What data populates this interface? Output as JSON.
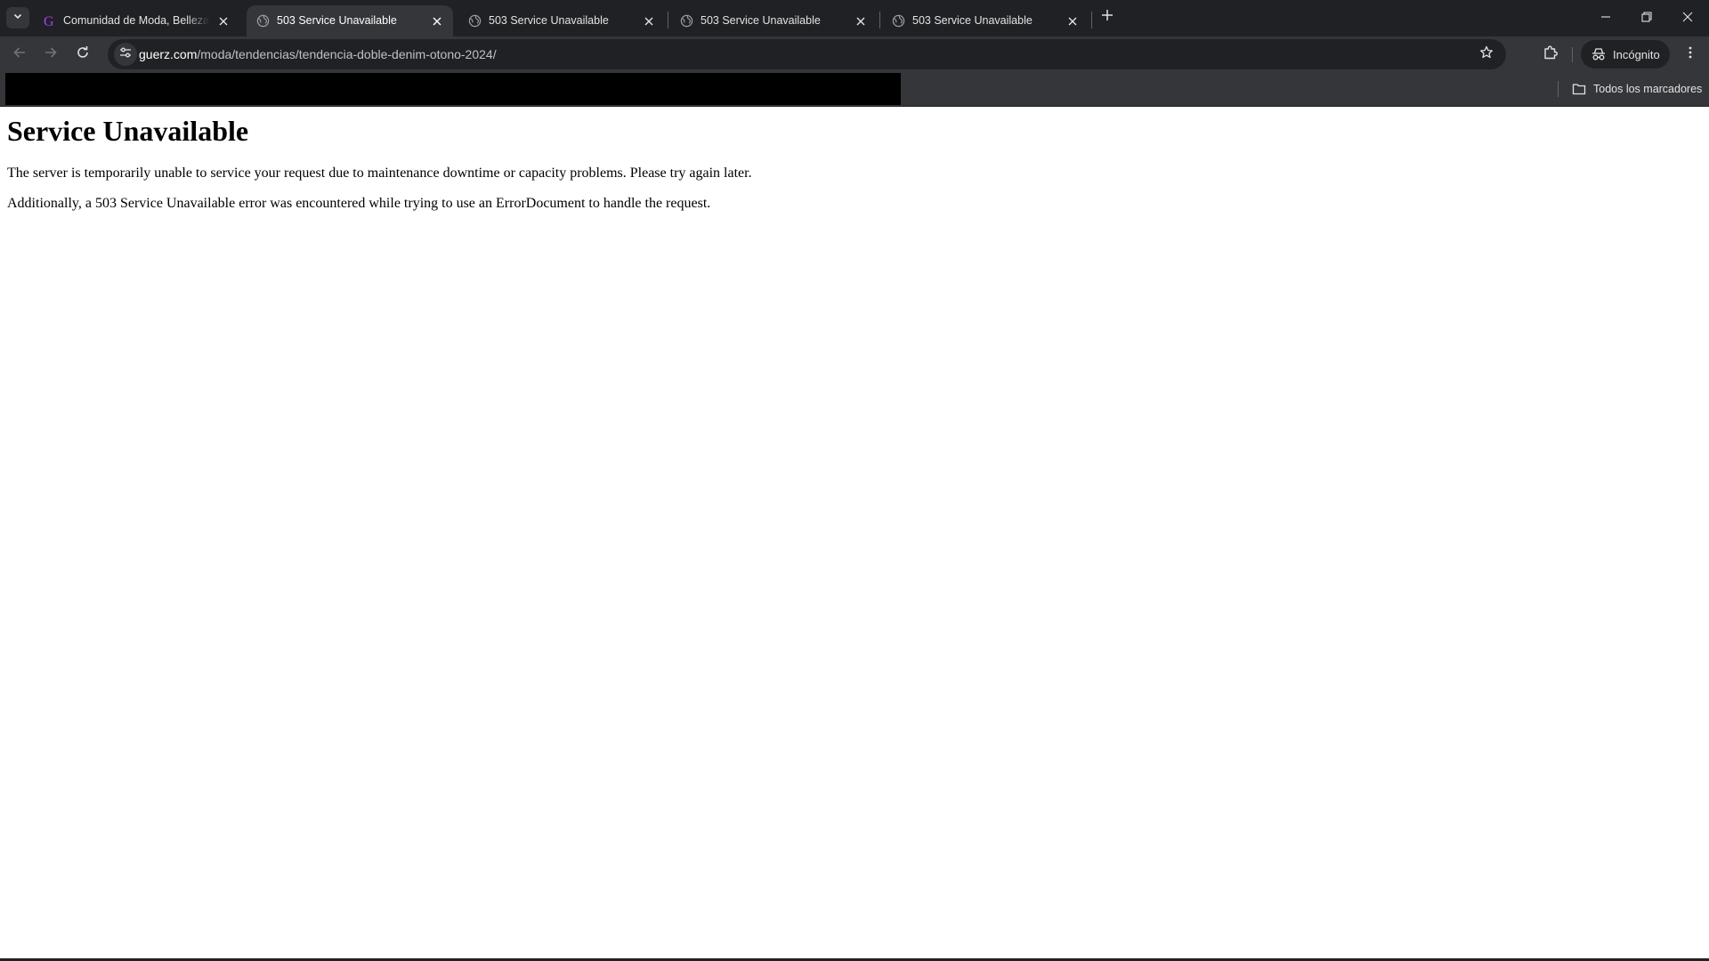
{
  "tabs": [
    {
      "title": "Comunidad de Moda, Belleza, Estilo de Vida",
      "favicon": "g-logo-icon",
      "active": false
    },
    {
      "title": "503 Service Unavailable",
      "favicon": "globe-icon",
      "active": true
    },
    {
      "title": "503 Service Unavailable",
      "favicon": "globe-icon",
      "active": false
    },
    {
      "title": "503 Service Unavailable",
      "favicon": "globe-icon",
      "active": false
    },
    {
      "title": "503 Service Unavailable",
      "favicon": "globe-icon",
      "active": false
    }
  ],
  "toolbar": {
    "url_host": "guerz.com",
    "url_path": "/moda/tendencias/tendencia-doble-denim-otono-2024/",
    "incognito_label": "Incógnito"
  },
  "bookmarks": {
    "all_bookmarks_label": "Todos los marcadores"
  },
  "page": {
    "heading": "Service Unavailable",
    "paragraph_1": "The server is temporarily unable to service your request due to maintenance downtime or capacity problems. Please try again later.",
    "paragraph_2": "Additionally, a 503 Service Unavailable error was encountered while trying to use an ErrorDocument to handle the request."
  },
  "colors": {
    "frame": "#202124",
    "toolbar": "#35363a",
    "favicon_g": "#a142f4",
    "page_bg": "#ffffff"
  }
}
